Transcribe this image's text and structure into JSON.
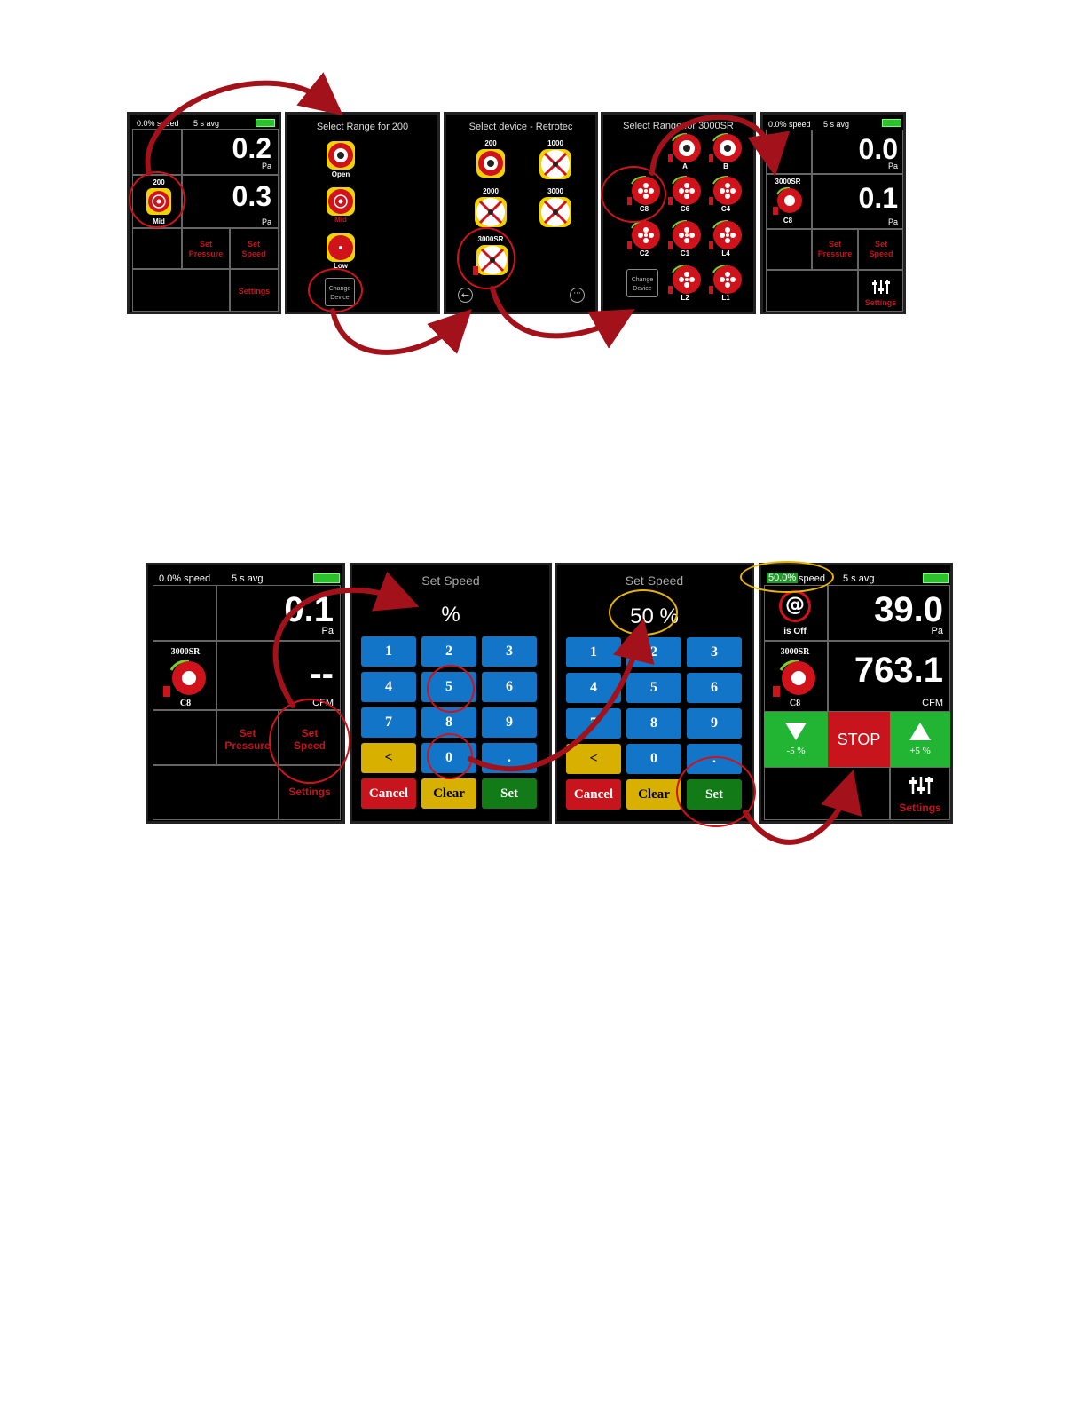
{
  "row1": {
    "s1": {
      "speed": "0.0% speed",
      "avg": "5 s avg",
      "v1": "0.2",
      "u1": "Pa",
      "v2": "0.3",
      "u2": "Pa",
      "device": "200",
      "range": "Mid",
      "set_pressure": "Set Pressure",
      "set_speed": "Set Speed",
      "settings": "Settings"
    },
    "s2": {
      "title": "Select Range for 200",
      "r1": "Open",
      "r2": "Mid",
      "r3": "Low",
      "change": "Change Device"
    },
    "s3": {
      "title": "Select device - Retrotec",
      "d1": "200",
      "d2": "1000",
      "d3": "2000",
      "d4": "3000",
      "d5": "3000SR"
    },
    "s4": {
      "title": "Select Range for 3000SR",
      "items": [
        "A",
        "B",
        "C8",
        "C6",
        "C4",
        "C2",
        "C1",
        "L4",
        "L2",
        "L1"
      ],
      "change": "Change Device"
    },
    "s5": {
      "speed": "0.0% speed",
      "avg": "5 s avg",
      "v1": "0.0",
      "u1": "Pa",
      "v2": "0.1",
      "u2": "Pa",
      "device": "3000SR",
      "range": "C8",
      "set_pressure": "Set Pressure",
      "set_speed": "Set Speed",
      "settings": "Settings"
    }
  },
  "row2": {
    "s1": {
      "speed": "0.0% speed",
      "avg": "5 s avg",
      "v1": "0.1",
      "u1": "Pa",
      "v2": "--",
      "u2": "CFM",
      "device": "3000SR",
      "range": "C8",
      "set_pressure": "Set Pressure",
      "set_speed": "Set Speed",
      "settings": "Settings"
    },
    "s2": {
      "title": "Set Speed",
      "value": "%",
      "keys": [
        "1",
        "2",
        "3",
        "4",
        "5",
        "6",
        "7",
        "8",
        "9",
        "<",
        "0",
        "."
      ],
      "cancel": "Cancel",
      "clear": "Clear",
      "set": "Set"
    },
    "s3": {
      "title": "Set Speed",
      "value": "50 %",
      "keys": [
        "1",
        "2",
        "3",
        "4",
        "5",
        "6",
        "7",
        "8",
        "9",
        "<",
        "0",
        "."
      ],
      "cancel": "Cancel",
      "clear": "Clear",
      "set": "Set"
    },
    "s4": {
      "speed_pct": "50.0%",
      "speed_word": "speed",
      "avg": "5 s avg",
      "v1": "39.0",
      "u1": "Pa",
      "v2": "763.1",
      "u2": "CFM",
      "is_off": "is Off",
      "device": "3000SR",
      "range": "C8",
      "minus": "-5 %",
      "stop": "STOP",
      "plus": "+5 %",
      "settings": "Settings"
    }
  },
  "colors": {
    "accent_red": "#c0141c",
    "arrow_red": "#a3121a",
    "highlight_yellow": "#e8b400",
    "key_blue": "#1275c8",
    "key_green": "#137a18"
  }
}
